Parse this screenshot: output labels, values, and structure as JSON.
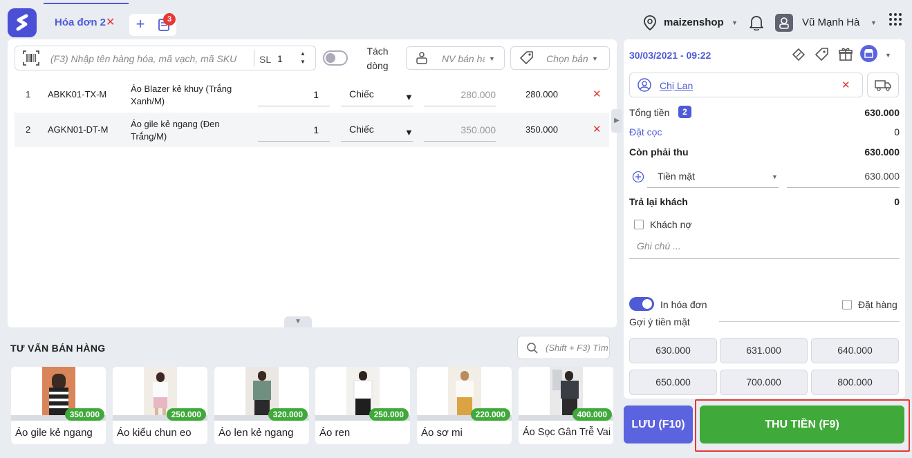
{
  "header": {
    "tab_title": "Hóa đơn 2",
    "tab_close": "✕",
    "add_tab": "+",
    "receipt_badge": "3",
    "shop_name": "maizenshop",
    "user_name": "Vũ Mạnh Hà"
  },
  "toolbar": {
    "search_placeholder": "(F3) Nhập tên hàng hóa, mã vạch, mã SKU",
    "qty_label": "SL",
    "qty_value": "1",
    "split_label": "Tách dòng",
    "seller_placeholder": "NV bán hà",
    "price_list_placeholder": "Chọn bản"
  },
  "items": [
    {
      "index": "1",
      "sku": "ABKK01-TX-M",
      "name": "Áo Blazer kẻ khuy (Trắng Xanh/M)",
      "qty": "1",
      "unit": "Chiếc",
      "price": "280.000",
      "total": "280.000"
    },
    {
      "index": "2",
      "sku": "AGKN01-DT-M",
      "name": "Áo gile kẻ ngang (Đen Trắng/M)",
      "qty": "1",
      "unit": "Chiếc",
      "price": "350.000",
      "total": "350.000"
    }
  ],
  "suggest": {
    "title": "TƯ VẤN BÁN HÀNG",
    "search_placeholder": "(Shift + F3) Tìm",
    "products": [
      {
        "name": "Áo gile kẻ ngang",
        "price": "350.000"
      },
      {
        "name": "Áo kiểu chun eo",
        "price": "250.000"
      },
      {
        "name": "Áo len kẻ ngang",
        "price": "320.000"
      },
      {
        "name": "Áo ren",
        "price": "250.000"
      },
      {
        "name": "Áo sơ mi",
        "price": "220.000"
      },
      {
        "name": "Áo Sọc Gân Trễ Vai",
        "price": "400.000"
      }
    ]
  },
  "checkout": {
    "datetime": "30/03/2021 - 09:22",
    "customer": "Chị Lan",
    "total_label": "Tổng tiền",
    "total_count": "2",
    "total_value": "630.000",
    "deposit_label": "Đặt cọc",
    "deposit_value": "0",
    "remaining_label": "Còn phải thu",
    "remaining_value": "630.000",
    "payment_method": "Tiền mặt",
    "payment_value": "630.000",
    "change_label": "Trả lại khách",
    "change_value": "0",
    "debt_label": "Khách nợ",
    "note_placeholder": "Ghi chú ...",
    "print_label": "In hóa đơn",
    "order_label": "Đặt hàng",
    "cash_suggest_label": "Gợi ý tiền mặt",
    "cash_suggestions": [
      "630.000",
      "631.000",
      "640.000",
      "650.000",
      "700.000",
      "800.000"
    ],
    "save_button": "LƯU (F10)",
    "pay_button": "THU TIỀN (F9)"
  },
  "colors": {
    "accent": "#4e5bd6",
    "pay_green": "#3fa93a",
    "danger": "#e53935"
  }
}
